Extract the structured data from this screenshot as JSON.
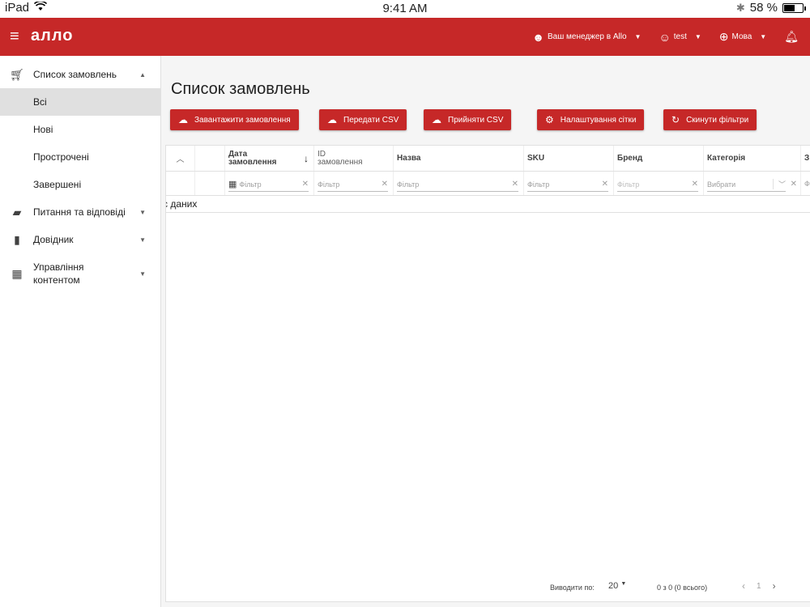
{
  "statusbar": {
    "device": "iPad",
    "wifi_icon": "wifi-icon",
    "time": "9:41 AM",
    "battery_text": "58 %",
    "battery_level": 0.58
  },
  "appbar": {
    "logo": "алло",
    "manager": "Ваш менеджер в Allo",
    "user": "test",
    "language": "Мова"
  },
  "sidebar": {
    "orders": "Список замовлень",
    "sub": [
      "Всі",
      "Нові",
      "Прострочені",
      "Завершені"
    ],
    "qa": "Питання та відповіді",
    "guide": "Довідник",
    "content_line1": "Управління",
    "content_line2": "контентом"
  },
  "main": {
    "title": "Список замовлень",
    "buttons": {
      "download": "Завантажити замовлення",
      "send_csv": "Передати CSV",
      "receive_csv": "Прийняти CSV",
      "grid_settings": "Налаштування сітки",
      "reset_filters": "Скинути фільтри"
    }
  },
  "grid": {
    "headers": {
      "date_line1": "Дата",
      "date_line2": "замовлення",
      "id_line1": "ID",
      "id_line2": "замовлення",
      "name": "Назва",
      "sku": "SKU",
      "brand": "Бренд",
      "category": "Категорія",
      "next": "З"
    },
    "filters": {
      "date": "Фільтр",
      "id": "Фільтр",
      "name": "Фільтр",
      "sku": "Фільтр",
      "brand": "Фільтр",
      "category": "Вибрати",
      "next": "Ф"
    },
    "nodata": "с даних"
  },
  "pager": {
    "label": "Виводити по:",
    "page_size": "20",
    "range": "0 з 0 (0 всього)",
    "page": "1"
  }
}
